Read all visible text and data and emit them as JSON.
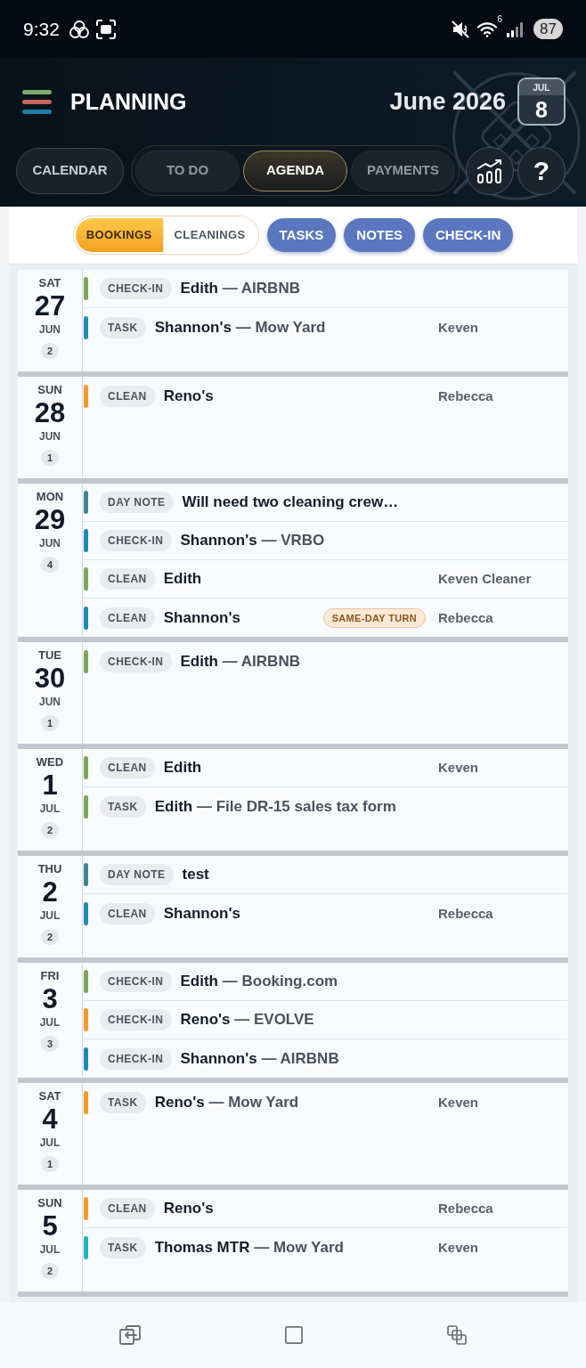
{
  "status_bar": {
    "time": "9:32",
    "wifi_badge": "6",
    "battery": "87"
  },
  "header": {
    "title": "PLANNING",
    "month": "June 2026",
    "today": {
      "month": "JUL",
      "day": "8"
    },
    "help": "?"
  },
  "nav_tabs": [
    {
      "label": "CALENDAR",
      "kind": "standalone",
      "selected": false
    },
    {
      "label": "TO DO",
      "kind": "grouped",
      "selected": false
    },
    {
      "label": "AGENDA",
      "kind": "grouped",
      "selected": true
    },
    {
      "label": "PAYMENTS",
      "kind": "grouped",
      "selected": false
    }
  ],
  "filters": {
    "segments": [
      {
        "label": "BOOKINGS",
        "selected": true
      },
      {
        "label": "CLEANINGS",
        "selected": false
      }
    ],
    "toggles": [
      {
        "label": "TASKS",
        "on": true
      },
      {
        "label": "NOTES",
        "on": true
      },
      {
        "label": "CHECK-IN",
        "on": true
      }
    ]
  },
  "days": [
    {
      "weekday": "SAT",
      "day": "27",
      "month": "JUN",
      "count": "2",
      "entries": [
        {
          "color": "#7ba65b",
          "tag": "CHECK-IN",
          "title": "Edith",
          "detail": "— AIRBNB"
        },
        {
          "color": "#1b8cb4",
          "tag": "TASK",
          "title": "Shannon's",
          "detail": "— Mow Yard",
          "assignee": "Keven"
        }
      ]
    },
    {
      "weekday": "SUN",
      "day": "28",
      "month": "JUN",
      "count": "1",
      "entries": [
        {
          "color": "#f39a2b",
          "tag": "CLEAN",
          "title": "Reno's",
          "assignee": "Rebecca"
        }
      ]
    },
    {
      "weekday": "MON",
      "day": "29",
      "month": "JUN",
      "count": "4",
      "entries": [
        {
          "color": "#3d8791",
          "tag": "DAY NOTE",
          "title": "Will need two cleaning crew…"
        },
        {
          "color": "#1b8cb4",
          "tag": "CHECK-IN",
          "title": "Shannon's",
          "detail": "— VRBO"
        },
        {
          "color": "#7ba65b",
          "tag": "CLEAN",
          "title": "Edith",
          "assignee": "Keven Cleaner"
        },
        {
          "color": "#1b8cb4",
          "tag": "CLEAN",
          "title": "Shannon's",
          "badge": "SAME-DAY TURN",
          "assignee": "Rebecca"
        }
      ]
    },
    {
      "weekday": "TUE",
      "day": "30",
      "month": "JUN",
      "count": "1",
      "entries": [
        {
          "color": "#7ba65b",
          "tag": "CHECK-IN",
          "title": "Edith",
          "detail": "— AIRBNB"
        }
      ]
    },
    {
      "weekday": "WED",
      "day": "1",
      "month": "JUL",
      "count": "2",
      "entries": [
        {
          "color": "#7ba65b",
          "tag": "CLEAN",
          "title": "Edith",
          "assignee": "Keven"
        },
        {
          "color": "#7ba65b",
          "tag": "TASK",
          "title": "Edith",
          "detail": "— File DR-15 sales tax form"
        }
      ]
    },
    {
      "weekday": "THU",
      "day": "2",
      "month": "JUL",
      "count": "2",
      "entries": [
        {
          "color": "#3d8791",
          "tag": "DAY NOTE",
          "title": "test"
        },
        {
          "color": "#1b8cb4",
          "tag": "CLEAN",
          "title": "Shannon's",
          "assignee": "Rebecca"
        }
      ]
    },
    {
      "weekday": "FRI",
      "day": "3",
      "month": "JUL",
      "count": "3",
      "entries": [
        {
          "color": "#7ba65b",
          "tag": "CHECK-IN",
          "title": "Edith",
          "detail": "— Booking.com"
        },
        {
          "color": "#f39a2b",
          "tag": "CHECK-IN",
          "title": "Reno's",
          "detail": "— EVOLVE"
        },
        {
          "color": "#1b8cb4",
          "tag": "CHECK-IN",
          "title": "Shannon's",
          "detail": "— AIRBNB"
        }
      ]
    },
    {
      "weekday": "SAT",
      "day": "4",
      "month": "JUL",
      "count": "1",
      "entries": [
        {
          "color": "#f39a2b",
          "tag": "TASK",
          "title": "Reno's",
          "detail": "— Mow Yard",
          "assignee": "Keven"
        }
      ]
    },
    {
      "weekday": "SUN",
      "day": "5",
      "month": "JUL",
      "count": "2",
      "entries": [
        {
          "color": "#f39a2b",
          "tag": "CLEAN",
          "title": "Reno's",
          "assignee": "Rebecca"
        },
        {
          "color": "#1fb3bd",
          "tag": "TASK",
          "title": "Thomas MTR",
          "detail": "— Mow Yard",
          "assignee": "Keven"
        }
      ]
    }
  ]
}
